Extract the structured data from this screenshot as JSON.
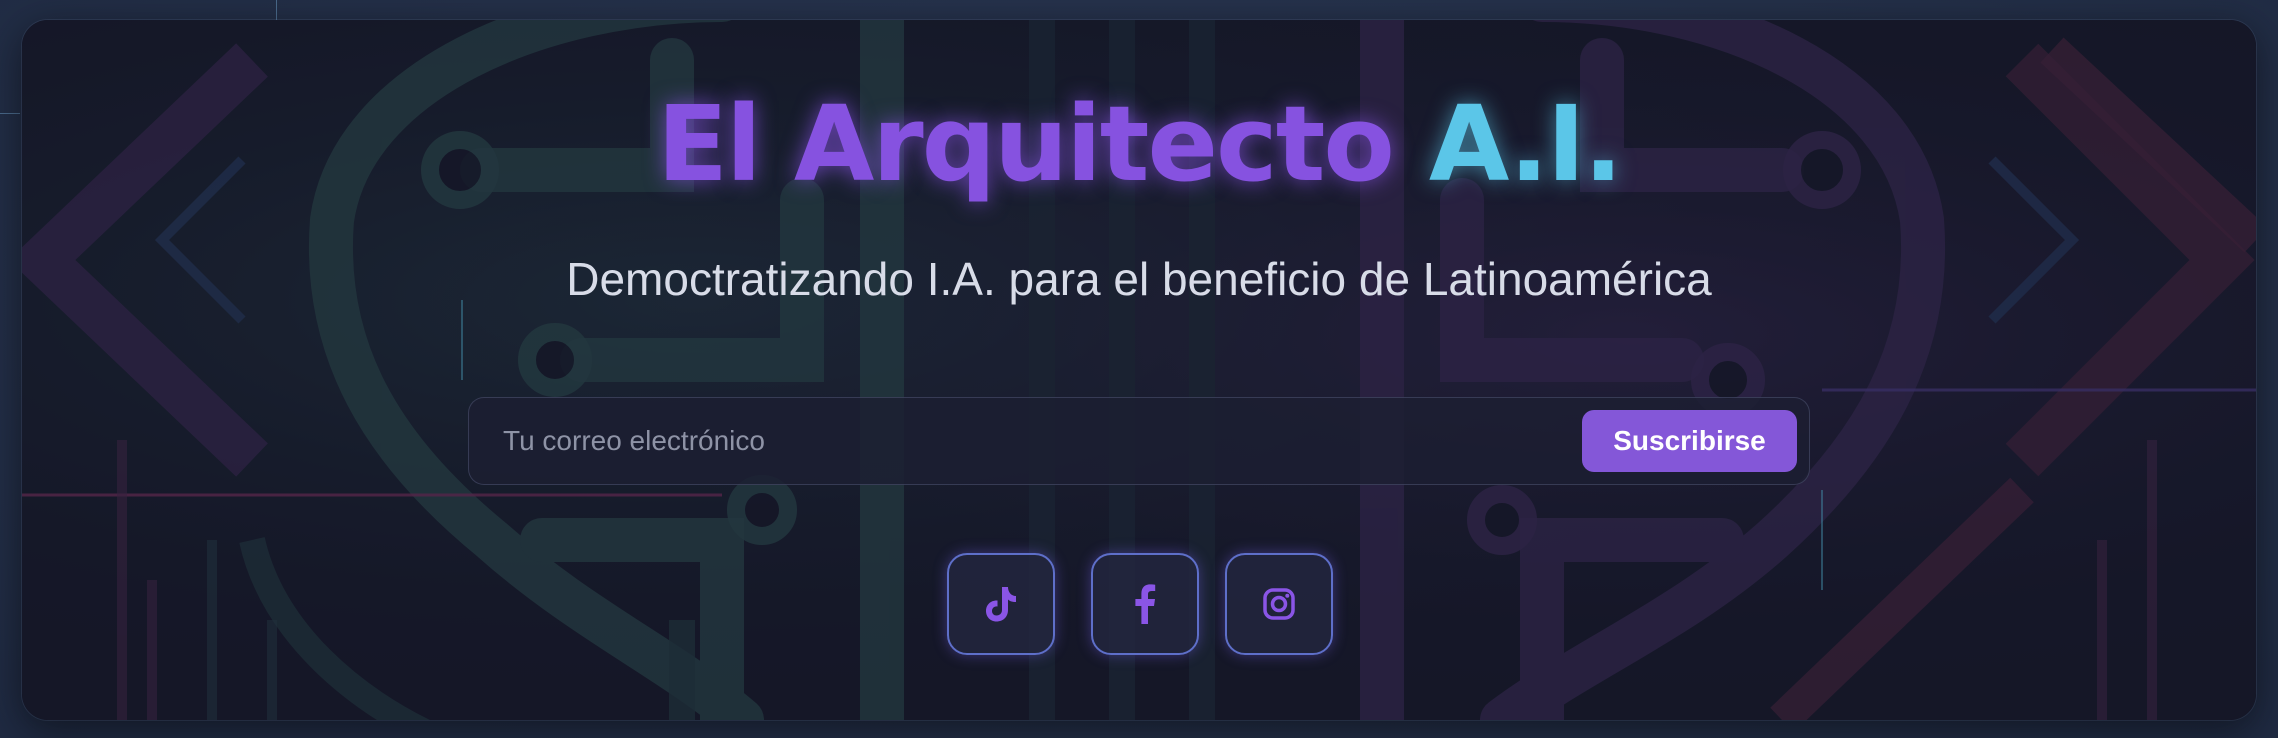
{
  "header": {
    "title_primary": "El Arquitecto",
    "title_accent": "A.I.",
    "subtitle": "Democtratizando I.A. para el beneficio de Latinoamérica"
  },
  "newsletter": {
    "email_placeholder": "Tu correo electrónico",
    "email_value": "",
    "subscribe_label": "Suscribirse"
  },
  "socials": [
    {
      "icon": "tiktok-icon"
    },
    {
      "icon": "facebook-icon"
    },
    {
      "icon": "instagram-icon"
    }
  ],
  "colors": {
    "title_primary": "#8652e0",
    "title_accent": "#5bc6e8",
    "button": "#8457d8",
    "page_bg": "#283550",
    "card_bg": "#161a2b"
  }
}
